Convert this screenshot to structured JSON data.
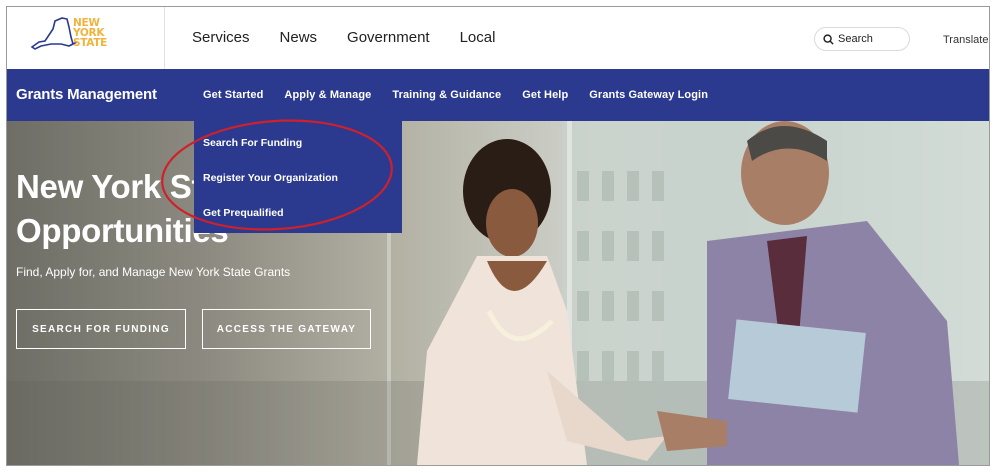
{
  "logo": {
    "line1": "NEW",
    "line2": "YORK",
    "line3": "STATE",
    "name": "nys-state-logo"
  },
  "top_nav": [
    "Services",
    "News",
    "Government",
    "Local"
  ],
  "search": {
    "label": "Search",
    "icon": "search-icon"
  },
  "translate": "Translate",
  "blue_nav": {
    "brand": "Grants Management",
    "items": [
      "Get Started",
      "Apply & Manage",
      "Training & Guidance",
      "Get Help",
      "Grants Gateway Login"
    ]
  },
  "dropdown": {
    "items": [
      "Search For Funding",
      "Register Your Organization",
      "Get Prequalified"
    ]
  },
  "hero": {
    "headline_line1": "New York State Grant",
    "headline_line2": "Opportunities",
    "subtext": "Find, Apply for, and Manage New York State Grants",
    "button1": "SEARCH FOR FUNDING",
    "button2": "ACCESS THE GATEWAY"
  },
  "colors": {
    "nav_blue": "#2b3a8f",
    "logo_gold": "#f2b33d",
    "annotation_red": "#d0202a"
  }
}
